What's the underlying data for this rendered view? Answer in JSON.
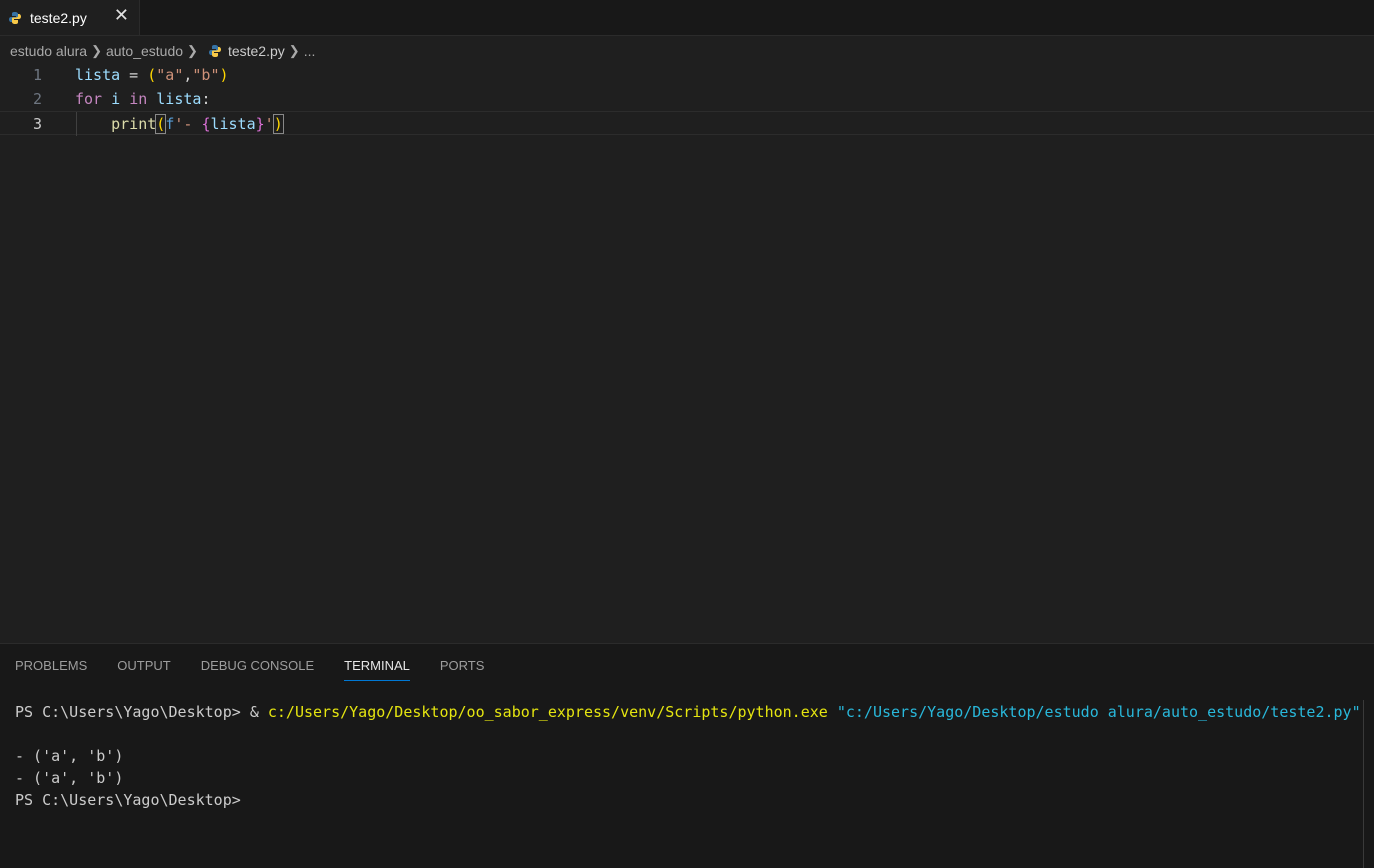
{
  "tab": {
    "label": "teste2.py",
    "close": "✕"
  },
  "breadcrumb": {
    "folder1": "estudo alura",
    "folder2": "auto_estudo",
    "file": "teste2.py",
    "more": "..."
  },
  "editor": {
    "lines": [
      {
        "number": "1"
      },
      {
        "number": "2"
      },
      {
        "number": "3"
      }
    ],
    "tokens": {
      "l1_var": "lista",
      "l1_eq": " = ",
      "l1_lp": "(",
      "l1_a": "\"a\"",
      "l1_comma": ",",
      "l1_b": "\"b\"",
      "l1_rp": ")",
      "l2_for": "for",
      "l2_i": " i ",
      "l2_in": "in",
      "l2_sp": " ",
      "l2_var": "lista",
      "l2_colon": ":",
      "l3_indent": "    ",
      "l3_print": "print",
      "l3_lp": "(",
      "l3_f": "f",
      "l3_str": "'- ",
      "l3_lb": "{",
      "l3_var": "lista",
      "l3_rb": "}",
      "l3_q": "'",
      "l3_rp": ")"
    }
  },
  "panel": {
    "tabs": [
      "PROBLEMS",
      "OUTPUT",
      "DEBUG CONSOLE",
      "TERMINAL",
      "PORTS"
    ],
    "active_tab": "TERMINAL"
  },
  "terminal": {
    "prompt": "PS C:\\Users\\Yago\\Desktop> ",
    "amp": "& ",
    "exe": "c:/Users/Yago/Desktop/oo_sabor_express/venv/Scripts/python.exe",
    "script": " \"c:/Users/Yago/Desktop/estudo alura/auto_estudo/teste2.py\"",
    "out1": "- ('a', 'b')",
    "out2": "- ('a', 'b')",
    "prompt2": "PS C:\\Users\\Yago\\Desktop>"
  },
  "colors": {
    "python_blue": "#3572a5",
    "python_yellow": "#f7c948",
    "accent": "#0078d4"
  },
  "icons": {
    "file_icon": "python-icon"
  }
}
